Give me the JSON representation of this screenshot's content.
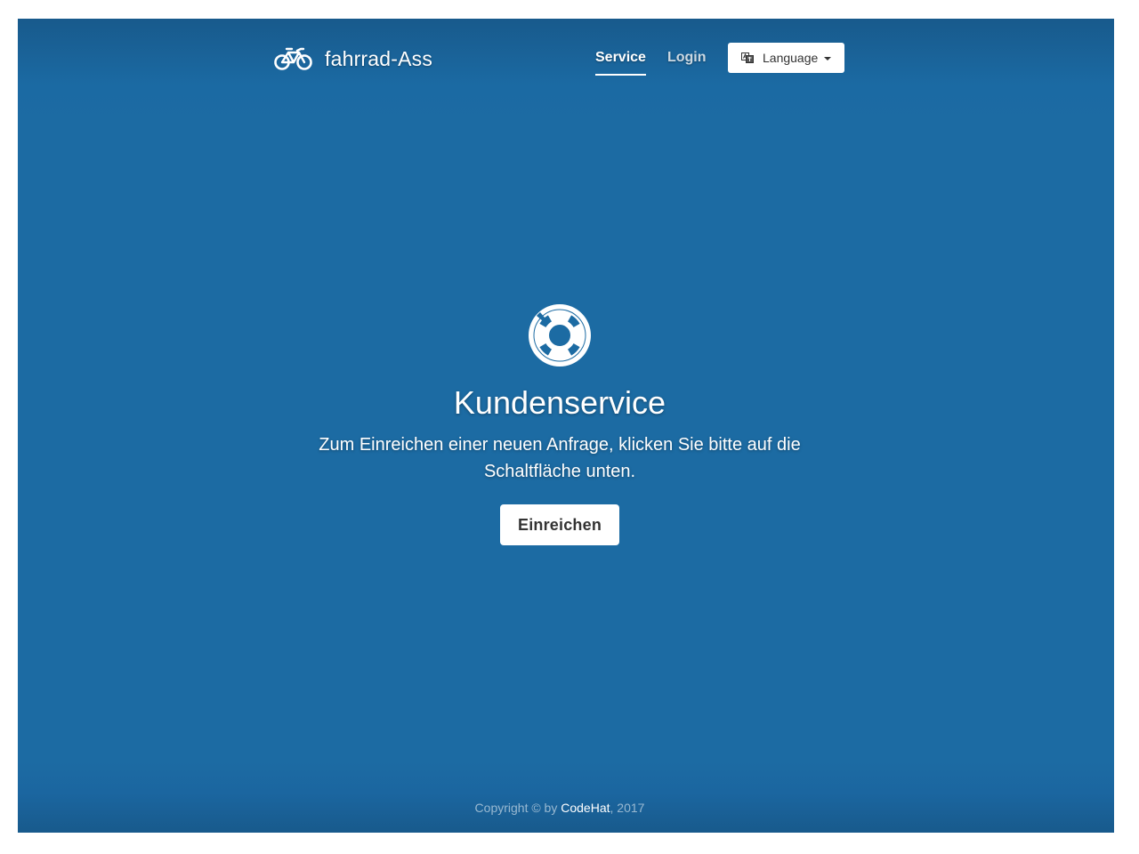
{
  "header": {
    "brand_name": "fahrrad-Ass",
    "brand_icon": "bicycle-icon",
    "nav": [
      {
        "label": "Service",
        "active": true
      },
      {
        "label": "Login",
        "active": false
      }
    ],
    "language": {
      "label": "Language",
      "icon": "language-icon"
    }
  },
  "hero": {
    "icon": "life-ring-icon",
    "title": "Kundenservice",
    "lead": "Zum Einreichen einer neuen Anfrage, klicken Sie bitte auf die Schaltfläche unten.",
    "button_label": "Einreichen"
  },
  "footer": {
    "prefix": "Copyright © by ",
    "link_text": "CodeHat",
    "suffix": ", 2017"
  },
  "colors": {
    "background": "#1c6ba3",
    "background_edge": "#185a8c",
    "text": "#ffffff",
    "button_text": "#333333"
  }
}
